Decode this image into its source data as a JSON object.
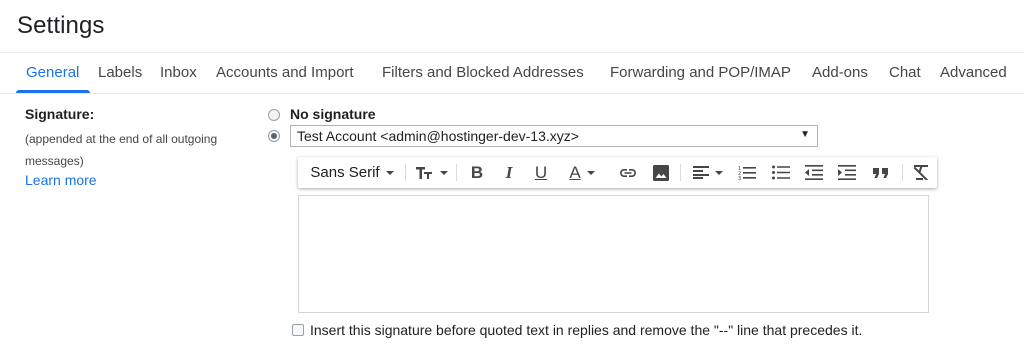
{
  "page": {
    "title": "Settings"
  },
  "tabs": [
    {
      "label": "General",
      "active": true
    },
    {
      "label": "Labels"
    },
    {
      "label": "Inbox"
    },
    {
      "label": "Accounts and Import"
    },
    {
      "label": "Filters and Blocked Addresses"
    },
    {
      "label": "Forwarding and POP/IMAP"
    },
    {
      "label": "Add-ons"
    },
    {
      "label": "Chat"
    },
    {
      "label": "Advanced"
    }
  ],
  "signature": {
    "label": "Signature:",
    "description": "(appended at the end of all outgoing messages)",
    "learn_more": "Learn more",
    "no_signature_label": "No signature",
    "selected_option": "account",
    "account_value": "Test Account <admin@hostinger-dev-13.xyz>",
    "editor_content": "",
    "insert_before_quoted_label": "Insert this signature before quoted text in replies and remove the \"--\" line that precedes it.",
    "insert_before_quoted_checked": false
  },
  "toolbar": {
    "font_label": "Sans Serif",
    "icons": [
      "font-size-icon",
      "bold-icon",
      "italic-icon",
      "underline-icon",
      "text-color-icon",
      "link-icon",
      "image-icon",
      "align-icon",
      "numbered-list-icon",
      "bulleted-list-icon",
      "indent-less-icon",
      "indent-more-icon",
      "quote-icon",
      "remove-formatting-icon"
    ]
  },
  "colors": {
    "accent": "#1a73e8",
    "text": "#202124",
    "muted": "#444746"
  }
}
